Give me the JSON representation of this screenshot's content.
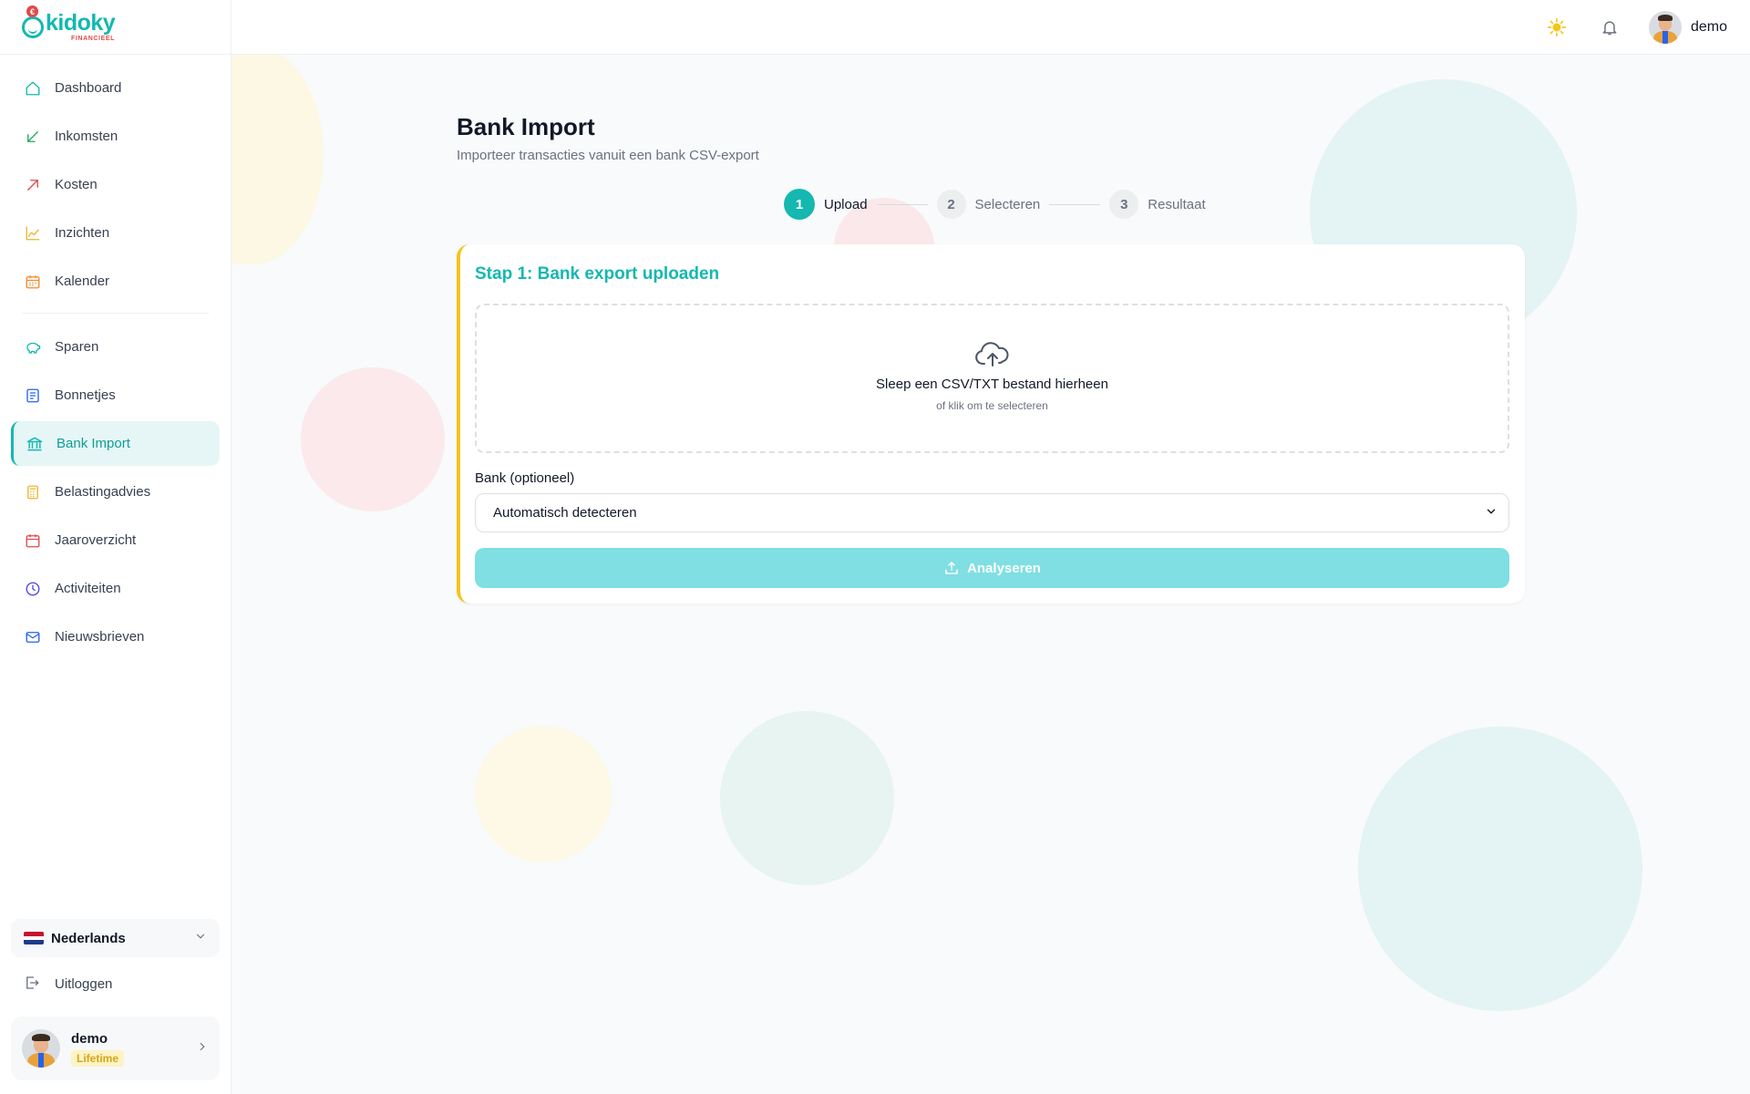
{
  "brand": {
    "name": "kidoky",
    "subtitle": "FINANCIEEL"
  },
  "sidebar": {
    "items": [
      {
        "label": "Dashboard",
        "icon": "home-icon"
      },
      {
        "label": "Inkomsten",
        "icon": "arrow-down-left-icon"
      },
      {
        "label": "Kosten",
        "icon": "arrow-up-right-icon"
      },
      {
        "label": "Inzichten",
        "icon": "line-chart-icon"
      },
      {
        "label": "Kalender",
        "icon": "calendar-icon"
      },
      {
        "label": "Sparen",
        "icon": "piggy-bank-icon"
      },
      {
        "label": "Bonnetjes",
        "icon": "receipt-icon"
      },
      {
        "label": "Bank Import",
        "icon": "bank-icon",
        "active": true
      },
      {
        "label": "Belastingadvies",
        "icon": "calculator-icon"
      },
      {
        "label": "Jaaroverzicht",
        "icon": "calendar-year-icon"
      },
      {
        "label": "Activiteiten",
        "icon": "clock-icon"
      },
      {
        "label": "Nieuwsbrieven",
        "icon": "mail-icon"
      }
    ],
    "language": "Nederlands",
    "logout": "Uitloggen",
    "user": {
      "name": "demo",
      "badge": "Lifetime"
    }
  },
  "topbar": {
    "user_name": "demo"
  },
  "page": {
    "title": "Bank Import",
    "subtitle": "Importeer transacties vanuit een bank CSV-export"
  },
  "stepper": [
    {
      "number": "1",
      "label": "Upload",
      "active": true
    },
    {
      "number": "2",
      "label": "Selecteren",
      "active": false
    },
    {
      "number": "3",
      "label": "Resultaat",
      "active": false
    }
  ],
  "card": {
    "title": "Stap 1: Bank export uploaden",
    "dropzone_main": "Sleep een CSV/TXT bestand hierheen",
    "dropzone_sub": "of klik om te selecteren",
    "bank_label": "Bank (optioneel)",
    "bank_value": "Automatisch detecteren",
    "analyze_label": "Analyseren"
  },
  "colors": {
    "accent": "#14b8b0",
    "card_border": "#f7c21b",
    "button_disabled": "#7fdfe2",
    "badge": "#d4a51a"
  }
}
